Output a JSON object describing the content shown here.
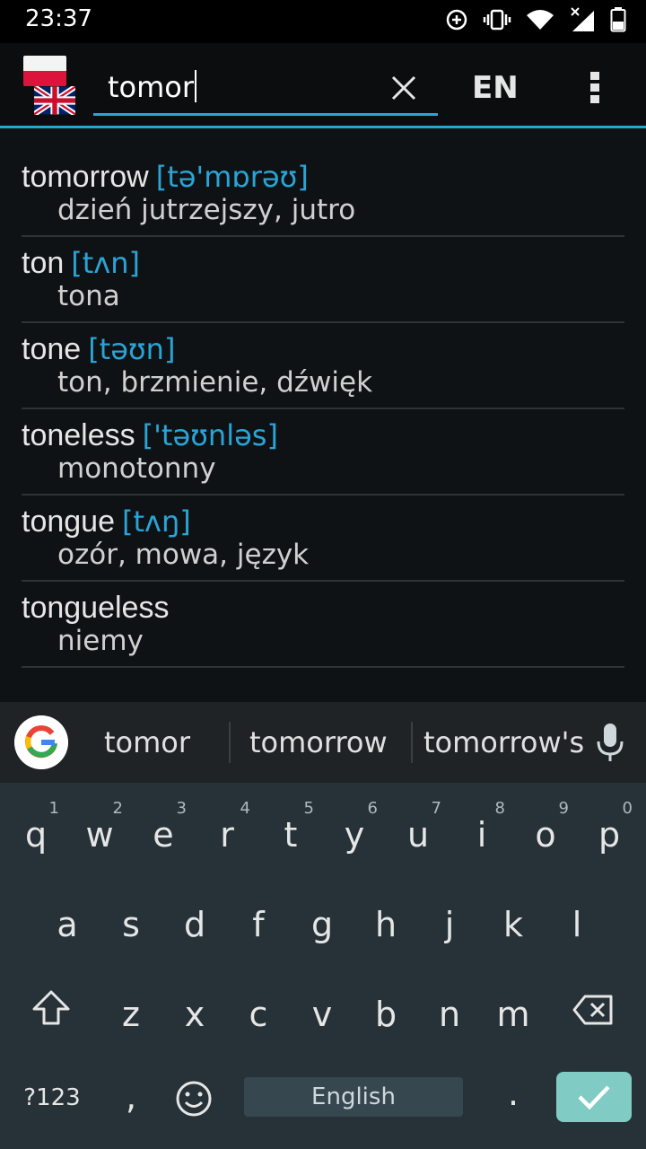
{
  "status_bar": {
    "time": "23:37"
  },
  "search": {
    "query": "tomor"
  },
  "app_bar": {
    "lang_label": "EN"
  },
  "entries": [
    {
      "word": "tomorrow",
      "pron": "[tə'mɒrəʊ]",
      "translation": "dzień jutrzejszy, jutro"
    },
    {
      "word": "ton",
      "pron": "[tʌn]",
      "translation": "tona"
    },
    {
      "word": "tone",
      "pron": "[təʊn]",
      "translation": "ton, brzmienie, dźwięk"
    },
    {
      "word": "toneless",
      "pron": "['təʊnləs]",
      "translation": "monotonny"
    },
    {
      "word": "tongue",
      "pron": "[tʌŋ]",
      "translation": "ozór, mowa, język"
    },
    {
      "word": "tongueless",
      "pron": "",
      "translation": "niemy"
    }
  ],
  "suggestions": [
    "tomor",
    "tomorrow",
    "tomorrow's"
  ],
  "keyboard": {
    "row1": [
      {
        "ch": "q",
        "hint": "1"
      },
      {
        "ch": "w",
        "hint": "2"
      },
      {
        "ch": "e",
        "hint": "3"
      },
      {
        "ch": "r",
        "hint": "4"
      },
      {
        "ch": "t",
        "hint": "5"
      },
      {
        "ch": "y",
        "hint": "6"
      },
      {
        "ch": "u",
        "hint": "7"
      },
      {
        "ch": "i",
        "hint": "8"
      },
      {
        "ch": "o",
        "hint": "9"
      },
      {
        "ch": "p",
        "hint": "0"
      }
    ],
    "row2": [
      "a",
      "s",
      "d",
      "f",
      "g",
      "h",
      "j",
      "k",
      "l"
    ],
    "row3": [
      "z",
      "x",
      "c",
      "v",
      "b",
      "n",
      "m"
    ],
    "symbols_label": "?123",
    "comma": ",",
    "period": ".",
    "space_label": "English"
  },
  "colors": {
    "accent": "#2aa4d6",
    "enter": "#80cbc4",
    "keyboard_bg": "#263238"
  }
}
